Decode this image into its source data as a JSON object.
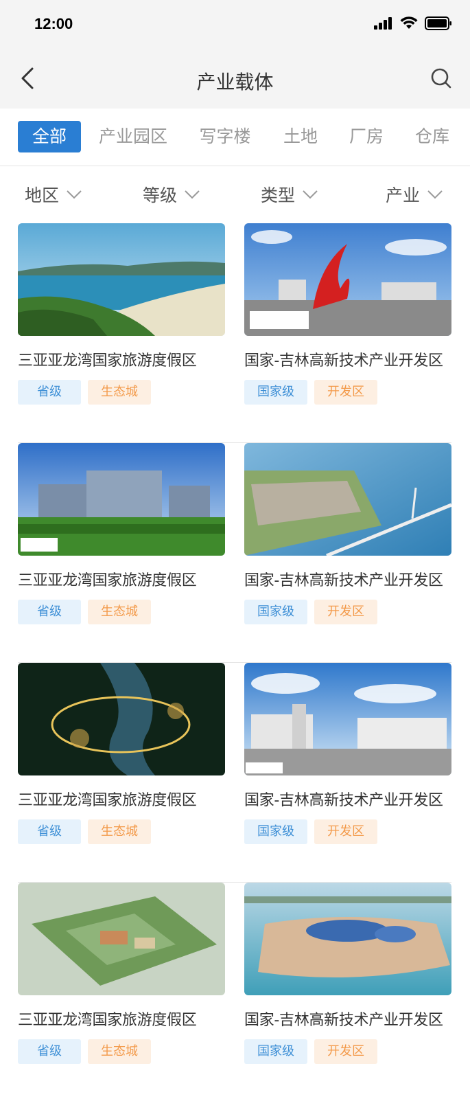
{
  "status": {
    "time": "12:00"
  },
  "nav": {
    "title": "产业载体",
    "back_icon": "chevron-left-icon",
    "search_icon": "search-icon"
  },
  "tabs": [
    {
      "label": "全部",
      "active": true
    },
    {
      "label": "产业园区",
      "active": false
    },
    {
      "label": "写字楼",
      "active": false
    },
    {
      "label": "土地",
      "active": false
    },
    {
      "label": "厂房",
      "active": false
    },
    {
      "label": "仓库",
      "active": false
    }
  ],
  "filters": [
    {
      "label": "地区"
    },
    {
      "label": "等级"
    },
    {
      "label": "类型"
    },
    {
      "label": "产业"
    }
  ],
  "colors": {
    "accent": "#2a7ed3",
    "tag_blue_bg": "#e6f2fc",
    "tag_blue_text": "#3d8fd6",
    "tag_orange_bg": "#fdefe2",
    "tag_orange_text": "#f39a4a"
  },
  "rows": [
    {
      "left": {
        "title": "三亚亚龙湾国家旅游度假区",
        "tags": [
          "省级",
          "生态城"
        ],
        "image": "bay-coastline"
      },
      "right": {
        "title": "国家-吉林高新技术产业开发区",
        "tags": [
          "国家级",
          "开发区"
        ],
        "image": "red-sculpture-plaza"
      }
    },
    {
      "left": {
        "title": "三亚亚龙湾国家旅游度假区",
        "tags": [
          "省级",
          "生态城"
        ],
        "image": "office-building-park"
      },
      "right": {
        "title": "国家-吉林高新技术产业开发区",
        "tags": [
          "国家级",
          "开发区"
        ],
        "image": "port-bridge"
      }
    },
    {
      "left": {
        "title": "三亚亚龙湾国家旅游度假区",
        "tags": [
          "省级",
          "生态城"
        ],
        "image": "night-river-island"
      },
      "right": {
        "title": "国家-吉林高新技术产业开发区",
        "tags": [
          "国家级",
          "开发区"
        ],
        "image": "factory-buildings-sky"
      }
    },
    {
      "left": {
        "title": "三亚亚龙湾国家旅游度假区",
        "tags": [
          "省级",
          "生态城"
        ],
        "image": "aerial-resort-park"
      },
      "right": {
        "title": "国家-吉林高新技术产业开发区",
        "tags": [
          "国家级",
          "开发区"
        ],
        "image": "waterfront-town"
      }
    }
  ]
}
